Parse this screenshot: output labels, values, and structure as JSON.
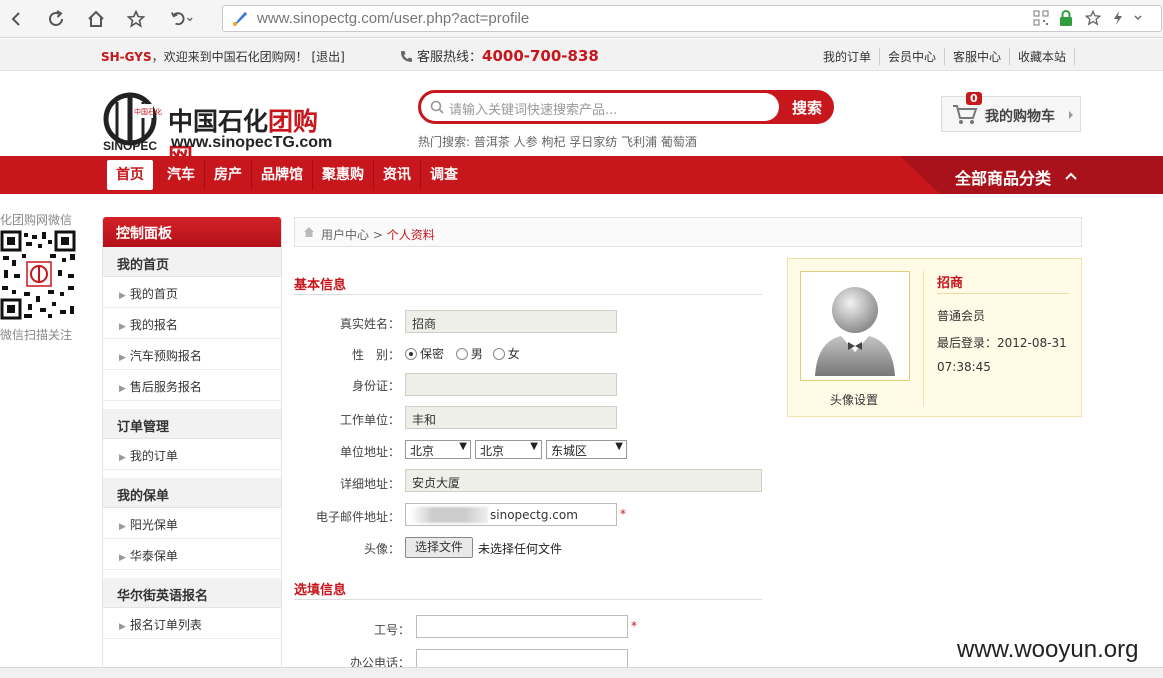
{
  "browser": {
    "url": "www.sinopectg.com/user.php?act=profile"
  },
  "topbar": {
    "brand": "SH-GYS",
    "welcome": "，欢迎来到中国石化团购网！",
    "logout": "[退出]",
    "hotline_label": "客服热线：",
    "hotline_number": "4000-700-838",
    "links": [
      "我的订单",
      "会员中心",
      "客服中心",
      "收藏本站"
    ]
  },
  "header": {
    "logo_cn_a": "中国石化",
    "logo_cn_b": "团购网",
    "logo_en": "www.sinopecTG.com",
    "search_placeholder": "请输入关键词快速搜索产品...",
    "search_button": "搜索",
    "hot_search": "热门搜索: 普洱茶 人参 枸杞 孚日家纺 飞利浦 葡萄酒",
    "cart_label": "我的购物车",
    "cart_count": "0"
  },
  "nav": {
    "items": [
      "首页",
      "汽车",
      "房产",
      "品牌馆",
      "聚惠购",
      "资讯",
      "调查"
    ],
    "all_categories": "全部商品分类"
  },
  "qr": {
    "title": "化团购网微信",
    "footer": "微信扫描关注"
  },
  "sidebar": {
    "header": "控制面板",
    "groups": [
      {
        "title": "我的首页",
        "items": [
          "我的首页",
          "我的报名",
          "汽车预购报名",
          "售后服务报名"
        ]
      },
      {
        "title": "订单管理",
        "items": [
          "我的订单"
        ]
      },
      {
        "title": "我的保单",
        "items": [
          "阳光保单",
          "华泰保单"
        ]
      },
      {
        "title": "华尔街英语报名",
        "items": [
          "报名订单列表"
        ]
      }
    ]
  },
  "breadcrumb": {
    "parent": "用户中心",
    "separator": ">",
    "current": "个人资料"
  },
  "form": {
    "basic_title": "基本信息",
    "name_label": "真实姓名：",
    "name_value": "招商",
    "gender_label": "性　别：",
    "gender_options": [
      "保密",
      "男",
      "女"
    ],
    "id_label": "身份证：",
    "id_value": "",
    "company_label": "工作单位：",
    "company_value": "丰和",
    "address_label": "单位地址：",
    "province": "北京",
    "city": "北京",
    "district": "东城区",
    "detail_label": "详细地址：",
    "detail_value": "安贞大厦",
    "email_label": "电子邮件地址：",
    "email_value": "sinopectg.com",
    "required_mark": "*",
    "avatar_label": "头像：",
    "file_button": "选择文件",
    "file_status": "未选择任何文件",
    "optional_title": "选填信息",
    "employee_label": "工号：",
    "office_phone_label": "办公电话："
  },
  "profile_card": {
    "name": "招商",
    "level": "普通会员",
    "last_login_label": "最后登录：",
    "last_login_value": "2012-08-31 07:38:45",
    "avatar_setting": "头像设置"
  },
  "watermark": "www.wooyun.org"
}
